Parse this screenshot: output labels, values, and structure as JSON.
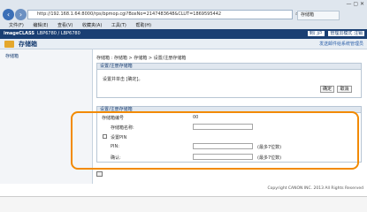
{
  "browser": {
    "address": "http://192.168.1.64:8000/rps/bpmop.cgi?BoxNo=2147483648&CLUT=18695954‌42",
    "tab_title": "存储箱",
    "back_icon": "arrow-left",
    "forward_icon": "arrow-right",
    "menu": [
      "文件(F)",
      "编辑(E)",
      "查看(V)",
      "收藏夹(A)",
      "工具(T)",
      "帮助(H)"
    ]
  },
  "app": {
    "brand": "imageCLASS",
    "printer": "LBP6780 / LBP6780",
    "right_links": [
      "到门户",
      "管理员模式 注销"
    ]
  },
  "page": {
    "title": "存储箱",
    "title_link": "发送邮件给系统管理员",
    "sidebar_item": "存储箱",
    "breadcrumb": "存储箱 : 存储箱 > 存储箱 > 设置/注册存储箱",
    "section1_title": "设置/注册存储箱",
    "section1_text": "设置并单击 [确定]。",
    "ok_label": "确定",
    "cancel_label": "取消",
    "section2_title": "设置/注册存储箱",
    "box_number_label": "存储箱编号",
    "box_number_value": "00",
    "box_name_label": "存储箱名称:",
    "set_pin_label": "设置PIN",
    "pin_label": "PIN:",
    "pin_hint": "(最多7位数)",
    "confirm_label": "确认:",
    "confirm_hint": "(最多7位数)",
    "copyright": "Copyright CANON INC. 2013 All Rights Reserved"
  }
}
